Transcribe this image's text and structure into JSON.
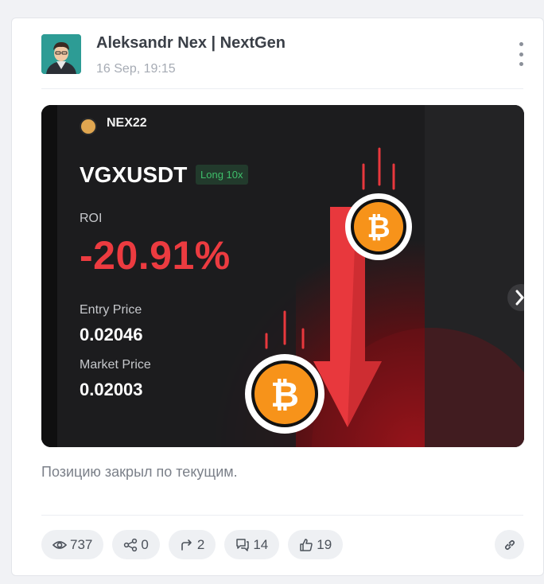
{
  "post": {
    "author": "Aleksandr Nex | NextGen",
    "date": "16 Sep, 19:15",
    "caption": "Позицию закрыл по текущим."
  },
  "trade_card": {
    "brand": "NEX22",
    "pair": "VGXUSDT",
    "leverage": "Long 10x",
    "roi_label": "ROI",
    "roi_value": "-20.91%",
    "entry_label": "Entry Price",
    "entry_value": "0.02046",
    "market_label": "Market Price",
    "market_value": "0.02003"
  },
  "stats": {
    "views": "737",
    "shares": "0",
    "reposts": "2",
    "comments": "14",
    "likes": "19"
  },
  "colors": {
    "roi_negative": "#ec3b40",
    "leverage_text": "#3fbf6a",
    "bitcoin": "#f7931a",
    "arrow": "#e8383d"
  },
  "icons": {
    "more": "more-vertical-icon",
    "views": "eye-icon",
    "shares": "share-icon",
    "reposts": "forward-icon",
    "comments": "comments-icon",
    "likes": "thumbs-up-icon",
    "link": "link-icon",
    "next": "chevron-right-icon"
  }
}
